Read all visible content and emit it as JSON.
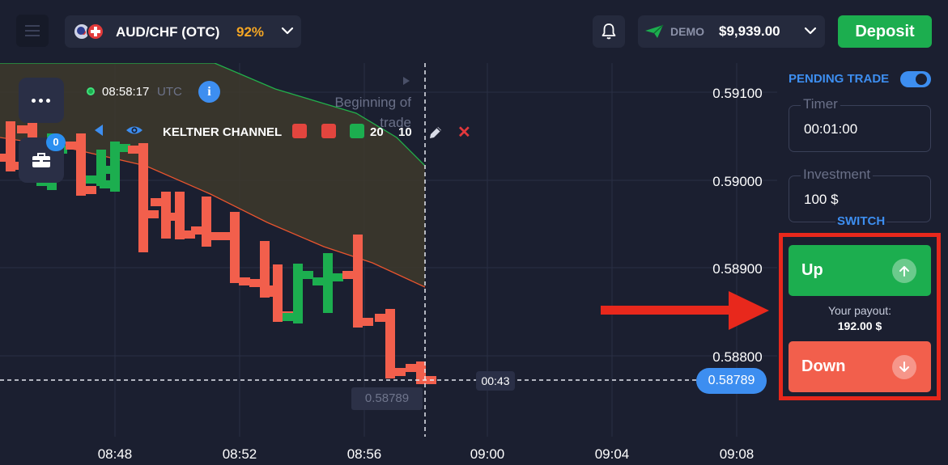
{
  "header": {
    "asset": {
      "name": "AUD/CHF (OTC)",
      "payout_pct": "92%"
    },
    "account": {
      "type": "DEMO",
      "balance": "$9,939.00"
    },
    "deposit_label": "Deposit"
  },
  "chart": {
    "server_time": "08:58:17",
    "timezone": "UTC",
    "info_label": "i",
    "trades_count": "0",
    "indicator": {
      "name": "KELTNER CHANNEL",
      "param1": "20",
      "param2": "10",
      "swatch_colors": [
        "#e2453e",
        "#e2453e",
        "#1cae4f"
      ]
    },
    "beginning_label": "Beginning of trade",
    "price_axis": [
      "0.59100",
      "0.59000",
      "0.58900",
      "0.58800"
    ],
    "time_axis": [
      "08:48",
      "08:52",
      "08:56",
      "09:00",
      "09:04",
      "09:08"
    ],
    "current_price": "0.58789",
    "hover_price": "0.58789",
    "countdown": "00:43",
    "colors": {
      "bull": "#1cae4f",
      "bear": "#f25f4c",
      "band_fill": "#3d3a2c",
      "upper_band": "#22b04a",
      "middle_band": "#e8542e",
      "accent": "#3d8ef0"
    }
  },
  "panel": {
    "pending_trade_label": "PENDING TRADE",
    "timer_label": "Timer",
    "timer_value": "00:01:00",
    "investment_label": "Investment",
    "investment_value": "100 $",
    "switch_label": "SWITCH",
    "up_label": "Up",
    "down_label": "Down",
    "payout_label": "Your payout:",
    "payout_value": "192.00 $"
  },
  "icons": [
    "menu-icon",
    "chevron-down-icon",
    "bell-icon",
    "paper-plane-icon",
    "more-dots-icon",
    "briefcase-icon",
    "info-icon",
    "eye-icon",
    "pencil-icon",
    "close-icon",
    "arrow-up-icon",
    "arrow-down-icon"
  ]
}
